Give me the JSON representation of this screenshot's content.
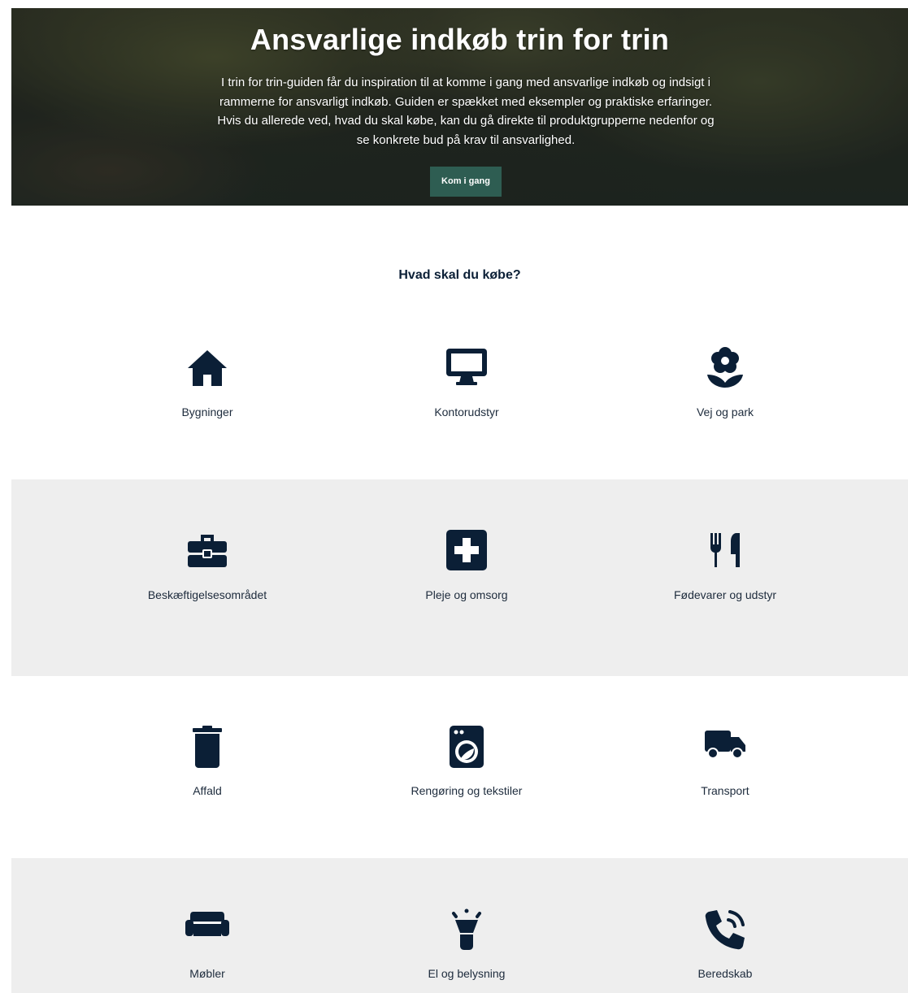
{
  "hero": {
    "title": "Ansvarlige indkøb trin for trin",
    "text": "I trin for trin-guiden får du inspiration til at komme i gang med ansvarlige indkøb og indsigt i rammerne for ansvarligt indkøb. Guiden er spækket med eksempler og praktiske erfaringer. Hvis du allerede ved, hvad du skal købe, kan du gå direkte til produktgrupperne nedenfor og se konkrete bud på krav til ansvarlighed.",
    "cta_label": "Kom i gang"
  },
  "section": {
    "title": "Hvad skal du købe?"
  },
  "categories": [
    {
      "label": "Bygninger",
      "icon": "house-icon"
    },
    {
      "label": "Kontorudstyr",
      "icon": "monitor-icon"
    },
    {
      "label": "Vej og park",
      "icon": "flower-icon"
    },
    {
      "label": "Beskæftigelsesområdet",
      "icon": "toolbox-icon"
    },
    {
      "label": "Pleje og omsorg",
      "icon": "medical-plus-icon"
    },
    {
      "label": "Fødevarer og udstyr",
      "icon": "utensils-icon"
    },
    {
      "label": "Affald",
      "icon": "trash-can-icon"
    },
    {
      "label": "Rengøring og tekstiler",
      "icon": "washing-machine-icon"
    },
    {
      "label": "Transport",
      "icon": "truck-icon"
    },
    {
      "label": "Møbler",
      "icon": "couch-icon"
    },
    {
      "label": "El og belysning",
      "icon": "flashlight-icon"
    },
    {
      "label": "Beredskab",
      "icon": "phone-volume-icon"
    }
  ],
  "colors": {
    "icon": "#0b1f36",
    "cta_background": "#2e5d52",
    "gray_band": "#eeeeee"
  }
}
